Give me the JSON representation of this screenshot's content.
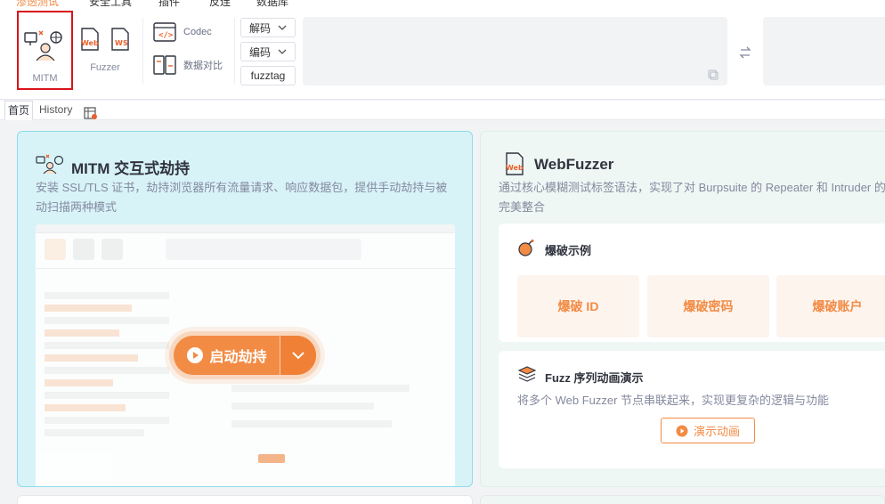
{
  "top_menu": {
    "items": [
      "渗透测试",
      "安全工具",
      "插件",
      "反连",
      "数据库"
    ]
  },
  "toolbar": {
    "mitm_label": "MITM",
    "fuzzer_label": "Fuzzer",
    "codec_label": "Codec",
    "data_compare_label": "数据对比",
    "decode_label": "解码",
    "encode_label": "编码",
    "fuzztag_label": "fuzztag"
  },
  "tabs": {
    "home": "首页",
    "history": "History"
  },
  "mitm_card": {
    "title": "MITM 交互式劫持",
    "desc": "安装 SSL/TLS 证书，劫持浏览器所有流量请求、响应数据包，提供手动劫持与被动扫描两种模式",
    "launch_label": "启动劫持"
  },
  "webfuzzer_card": {
    "title": "WebFuzzer",
    "desc": "通过核心模糊测试标签语法，实现了对 Burpsuite 的 Repeater 和 Intruder 的完美整合",
    "brute_title": "爆破示例",
    "brute_buttons": [
      "爆破 ID",
      "爆破密码",
      "爆破账户"
    ],
    "seq_title": "Fuzz 序列动画演示",
    "seq_desc": "将多个 Web Fuzzer 节点串联起来，实现更复杂的逻辑与功能",
    "demo_label": "演示动画"
  },
  "colors": {
    "accent": "#f28b44",
    "highlight_border": "#d9131a",
    "mitm_bg": "#d7f3f8"
  }
}
